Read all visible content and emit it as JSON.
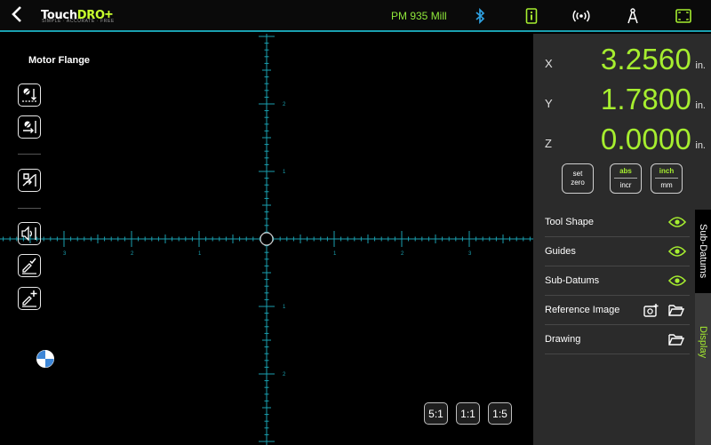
{
  "header": {
    "logo_touch": "Touch",
    "logo_dro": "DRO",
    "logo_plus": "+",
    "logo_tagline": "SIMPLE · ACCURATE · FREE",
    "machine_name": "PM 935 Mill",
    "icons": [
      "back-arrow-icon",
      "bluetooth-icon",
      "info-icon",
      "wireless-signal-icon",
      "compass-icon",
      "fullscreen-icon"
    ]
  },
  "canvas": {
    "title": "Motor Flange",
    "scale_labels": {
      "y_up": [
        "2",
        "1"
      ],
      "y_down": [
        "1",
        "2"
      ],
      "x_left": [
        "3",
        "2",
        "1"
      ],
      "x_right": [
        "1",
        "2",
        "3"
      ]
    },
    "zoom_buttons": [
      "5:1",
      "1:1",
      "1:5"
    ],
    "accent_color": "#1aa0b0"
  },
  "readout": {
    "axes": [
      {
        "label": "X",
        "value": "3.2560",
        "unit": "in."
      },
      {
        "label": "Y",
        "value": "1.7800",
        "unit": "in."
      },
      {
        "label": "Z",
        "value": "0.0000",
        "unit": "in."
      }
    ],
    "value_color": "#a6ee2f"
  },
  "modes": {
    "zero": {
      "top": "set",
      "bottom": "zero"
    },
    "abs": {
      "top": "abs",
      "bottom": "incr"
    },
    "unit": {
      "top": "inch",
      "bottom": "mm"
    }
  },
  "display": {
    "items": [
      {
        "label": "Tool Shape"
      },
      {
        "label": "Guides"
      },
      {
        "label": "Sub-Datums"
      },
      {
        "label": "Reference Image"
      },
      {
        "label": "Drawing"
      }
    ]
  },
  "side_tabs": {
    "sub_datums": "Sub-Datums",
    "display": "Display"
  }
}
